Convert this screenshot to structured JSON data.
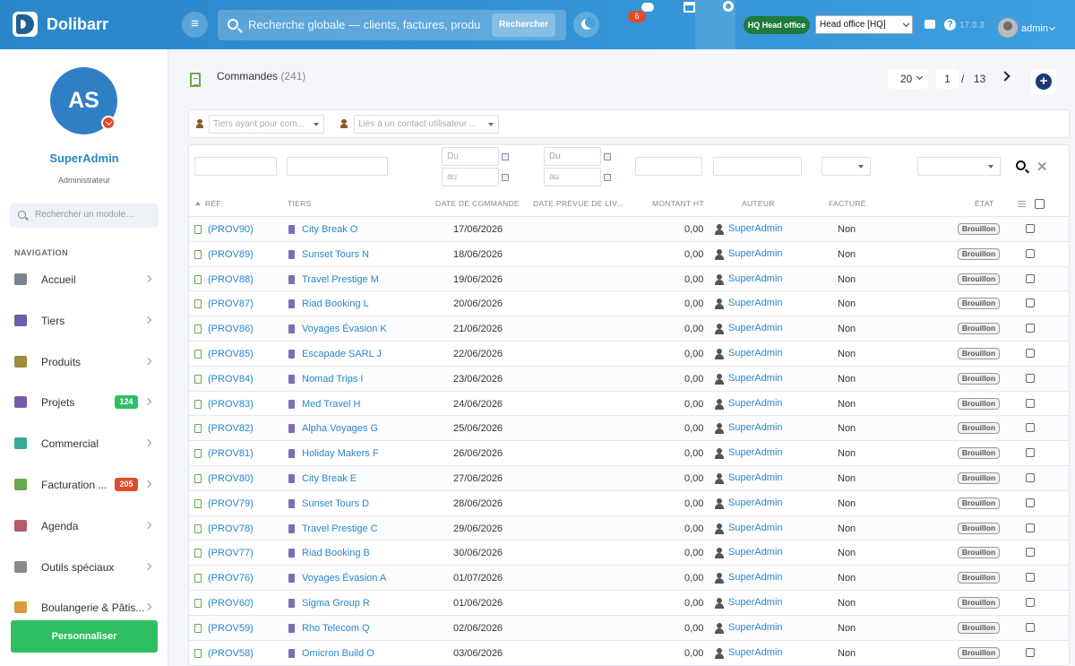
{
  "app": {
    "name": "Dolibarr",
    "search_placeholder": "Recherche globale — clients, factures, produits…",
    "search_button": "Rechercher",
    "notification_count": "6",
    "entity_badge": "HQ Head office",
    "entity_select": "Head office [HQ]",
    "version": "17.0.3",
    "user": "admin"
  },
  "sidebar": {
    "avatar_initials": "AS",
    "user_name": "SuperAdmin",
    "user_role": "Administrateur",
    "module_search_placeholder": "Rechercher un module…",
    "nav_heading": "NAVIGATION",
    "items": [
      {
        "label": "Accueil",
        "icon": "home-icon",
        "color": "#7a8591"
      },
      {
        "label": "Tiers",
        "icon": "building-icon",
        "color": "#6a5fa8"
      },
      {
        "label": "Produits",
        "icon": "box-icon",
        "color": "#a08a3c"
      },
      {
        "label": "Projets",
        "icon": "sitemap-icon",
        "color": "#7a5aa8",
        "badge": "124",
        "badge_color": "#2fbf63"
      },
      {
        "label": "Commercial",
        "icon": "briefcase-icon",
        "color": "#3aa89a"
      },
      {
        "label": "Facturation ...",
        "icon": "invoice-icon",
        "color": "#6aa84f",
        "badge": "205",
        "badge_color": "#e04b2c"
      },
      {
        "label": "Agenda",
        "icon": "calendar-icon",
        "color": "#b25a6e"
      },
      {
        "label": "Outils spéciaux",
        "icon": "tools-icon",
        "color": "#8a8a8a"
      },
      {
        "label": "Boulangerie & Pâtis...",
        "icon": "bread-icon",
        "color": "#d89a3a"
      }
    ],
    "customize_button": "Personnaliser"
  },
  "header": {
    "title": "Commandes",
    "count": "(241)",
    "per_page": "20",
    "page": "1",
    "page_sep": "/",
    "page_total": "13"
  },
  "filters": {
    "thirdparty_placeholder": "Tiers ayant pour com...",
    "contact_placeholder": "Liés à un contact utilisateur ...",
    "date_from": "Du",
    "date_to": "au"
  },
  "columns": {
    "ref": "RÉF.",
    "tiers": "TIERS",
    "order_date": "DATE DE COMMANDE",
    "delivery_date": "DATE PRÉVUE DE LIV...",
    "amount": "MONTANT HT",
    "author": "AUTEUR",
    "billed": "FACTURÉ",
    "status": "ÉTAT"
  },
  "rows": [
    {
      "ref": "(PROV90)",
      "tiers": "City Break O",
      "date": "17/06/2026",
      "amount": "0,00",
      "author": "SuperAdmin",
      "billed": "Non",
      "status": "Brouillon"
    },
    {
      "ref": "(PROV89)",
      "tiers": "Sunset Tours N",
      "date": "18/06/2026",
      "amount": "0,00",
      "author": "SuperAdmin",
      "billed": "Non",
      "status": "Brouillon"
    },
    {
      "ref": "(PROV88)",
      "tiers": "Travel Prestige M",
      "date": "19/06/2026",
      "amount": "0,00",
      "author": "SuperAdmin",
      "billed": "Non",
      "status": "Brouillon"
    },
    {
      "ref": "(PROV87)",
      "tiers": "Riad Booking L",
      "date": "20/06/2026",
      "amount": "0,00",
      "author": "SuperAdmin",
      "billed": "Non",
      "status": "Brouillon"
    },
    {
      "ref": "(PROV86)",
      "tiers": "Voyages Évasion K",
      "date": "21/06/2026",
      "amount": "0,00",
      "author": "SuperAdmin",
      "billed": "Non",
      "status": "Brouillon"
    },
    {
      "ref": "(PROV85)",
      "tiers": "Escapade SARL J",
      "date": "22/06/2026",
      "amount": "0,00",
      "author": "SuperAdmin",
      "billed": "Non",
      "status": "Brouillon"
    },
    {
      "ref": "(PROV84)",
      "tiers": "Nomad Trips I",
      "date": "23/06/2026",
      "amount": "0,00",
      "author": "SuperAdmin",
      "billed": "Non",
      "status": "Brouillon"
    },
    {
      "ref": "(PROV83)",
      "tiers": "Med Travel H",
      "date": "24/06/2026",
      "amount": "0,00",
      "author": "SuperAdmin",
      "billed": "Non",
      "status": "Brouillon"
    },
    {
      "ref": "(PROV82)",
      "tiers": "Alpha Voyages G",
      "date": "25/06/2026",
      "amount": "0,00",
      "author": "SuperAdmin",
      "billed": "Non",
      "status": "Brouillon"
    },
    {
      "ref": "(PROV81)",
      "tiers": "Holiday Makers F",
      "date": "26/06/2026",
      "amount": "0,00",
      "author": "SuperAdmin",
      "billed": "Non",
      "status": "Brouillon"
    },
    {
      "ref": "(PROV80)",
      "tiers": "City Break E",
      "date": "27/06/2026",
      "amount": "0,00",
      "author": "SuperAdmin",
      "billed": "Non",
      "status": "Brouillon"
    },
    {
      "ref": "(PROV79)",
      "tiers": "Sunset Tours D",
      "date": "28/06/2026",
      "amount": "0,00",
      "author": "SuperAdmin",
      "billed": "Non",
      "status": "Brouillon"
    },
    {
      "ref": "(PROV78)",
      "tiers": "Travel Prestige C",
      "date": "29/06/2026",
      "amount": "0,00",
      "author": "SuperAdmin",
      "billed": "Non",
      "status": "Brouillon"
    },
    {
      "ref": "(PROV77)",
      "tiers": "Riad Booking B",
      "date": "30/06/2026",
      "amount": "0,00",
      "author": "SuperAdmin",
      "billed": "Non",
      "status": "Brouillon"
    },
    {
      "ref": "(PROV76)",
      "tiers": "Voyages Évasion A",
      "date": "01/07/2026",
      "amount": "0,00",
      "author": "SuperAdmin",
      "billed": "Non",
      "status": "Brouillon"
    },
    {
      "ref": "(PROV60)",
      "tiers": "Sigma Group R",
      "date": "01/06/2026",
      "amount": "0,00",
      "author": "SuperAdmin",
      "billed": "Non",
      "status": "Brouillon"
    },
    {
      "ref": "(PROV59)",
      "tiers": "Rho Telecom Q",
      "date": "02/06/2026",
      "amount": "0,00",
      "author": "SuperAdmin",
      "billed": "Non",
      "status": "Brouillon"
    },
    {
      "ref": "(PROV58)",
      "tiers": "Omicron Build O",
      "date": "03/06/2026",
      "amount": "0,00",
      "author": "SuperAdmin",
      "billed": "Non",
      "status": "Brouillon"
    }
  ]
}
